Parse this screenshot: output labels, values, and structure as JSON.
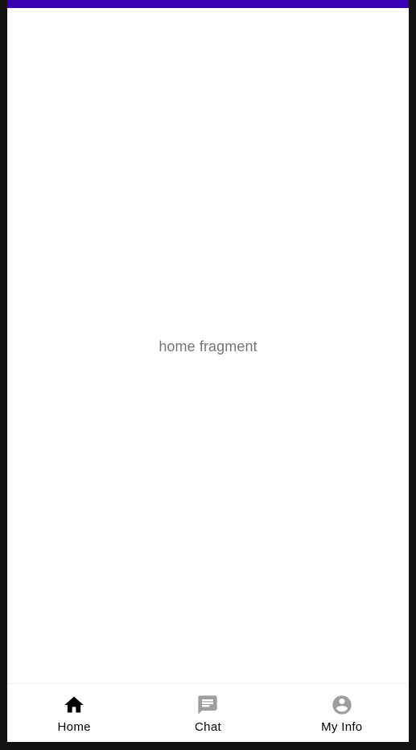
{
  "status_bar": {
    "color": "#3700B3"
  },
  "main": {
    "fragment_text": "home fragment"
  },
  "bottom_nav": {
    "active_color": "#000000",
    "inactive_color": "#9E9E9E",
    "items": [
      {
        "label": "Home",
        "icon": "home-icon",
        "selected": true
      },
      {
        "label": "Chat",
        "icon": "chat-icon",
        "selected": false
      },
      {
        "label": "My Info",
        "icon": "account-icon",
        "selected": false
      }
    ]
  }
}
